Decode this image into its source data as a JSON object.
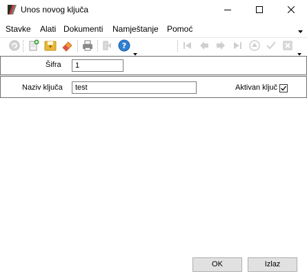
{
  "window": {
    "title": "Unos novog ključa",
    "icon": "app-logo-icon"
  },
  "menu": {
    "items": [
      "Stavke",
      "Alati",
      "Dokumenti",
      "Namještanje",
      "Pomoć"
    ]
  },
  "toolbar": {
    "icons": [
      "refresh-icon",
      "new-document-icon",
      "save-icon",
      "eraser-icon",
      "print-icon",
      "exit-icon",
      "help-icon",
      "dropdown-icon",
      "first-icon",
      "previous-icon",
      "next-icon",
      "last-icon",
      "up-icon",
      "confirm-icon",
      "cancel-icon",
      "more-icon"
    ]
  },
  "form": {
    "sifra_label": "Šifra",
    "sifra_value": "1",
    "naziv_label": "Naziv ključa",
    "naziv_value": "test",
    "aktivan_label": "Aktivan ključ",
    "aktivan_checked": true
  },
  "buttons": {
    "ok": "OK",
    "cancel": "Izlaz"
  }
}
